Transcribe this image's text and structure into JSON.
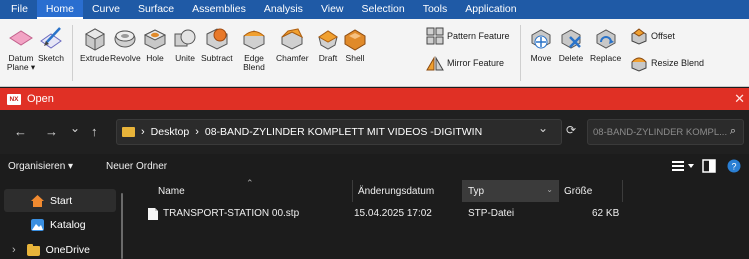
{
  "menubar": {
    "items": [
      "File",
      "Home",
      "Curve",
      "Surface",
      "Assemblies",
      "Analysis",
      "View",
      "Selection",
      "Tools",
      "Application"
    ],
    "active_index": 1
  },
  "ribbon": {
    "datum_plane_label": "Datum Plane ▾",
    "sketch_label": "Sketch",
    "extrude_label": "Extrude",
    "revolve_label": "Revolve",
    "hole_label": "Hole",
    "unite_label": "Unite",
    "subtract_label": "Subtract",
    "edge_blend_label": "Edge Blend",
    "chamfer_label": "Chamfer",
    "draft_label": "Draft",
    "shell_label": "Shell",
    "pattern_feature_label": "Pattern Feature",
    "mirror_feature_label": "Mirror Feature",
    "move_label": "Move",
    "delete_label": "Delete",
    "replace_label": "Replace",
    "offset_label": "Offset",
    "resize_blend_label": "Resize Blend"
  },
  "dialog": {
    "app_icon_text": "NX",
    "title": "Open",
    "close_glyph": "✕"
  },
  "address": {
    "back_glyph": "←",
    "forward_glyph": "→",
    "recent_glyph": "⌄",
    "up_glyph": "↑",
    "breadcrumb": [
      "Desktop",
      "08-BAND-ZYLINDER KOMPLETT MIT VIDEOS -DIGITWIN"
    ],
    "chevron_glyph": "›",
    "dropdown_glyph": "⌄",
    "refresh_glyph": "⟳",
    "search_placeholder": "08-BAND-ZYLINDER KOMPL...",
    "search_glyph": "⌕"
  },
  "commandbar": {
    "organize_label": "Organisieren ▾",
    "new_folder_label": "Neuer Ordner"
  },
  "sidebar": {
    "items": [
      {
        "label": "Start",
        "icon": "home-icon"
      },
      {
        "label": "Katalog",
        "icon": "gallery-icon"
      },
      {
        "label": "OneDrive",
        "icon": "folder-icon"
      }
    ],
    "expand_glyph": "›"
  },
  "filelist": {
    "columns": [
      "Name",
      "Änderungsdatum",
      "Typ",
      "Größe"
    ],
    "rows": [
      {
        "name": "TRANSPORT-STATION 00.stp",
        "date": "15.04.2025 17:02",
        "type": "STP-Datei",
        "size": "62 KB"
      }
    ]
  },
  "colors": {
    "menubar_bg": "#1f5aa6",
    "dialog_title_bg": "#e03025",
    "explorer_bg": "#1c1c1c",
    "folder_yellow": "#e8b43a"
  }
}
